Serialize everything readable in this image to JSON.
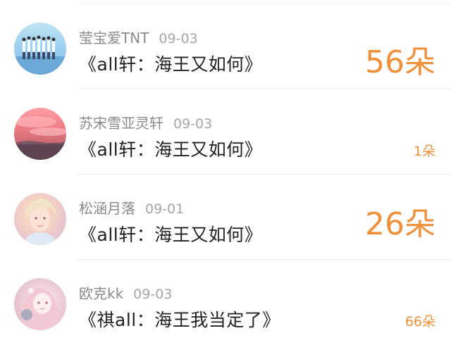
{
  "comments": [
    {
      "username": "莹宝爱TNT",
      "date": "09-03",
      "title": "《all轩：海王又如何》",
      "flowers": "56朵",
      "avatar_icon": "avatar-group-photo-icon"
    },
    {
      "username": "苏宋雪亚灵轩",
      "date": "09-03",
      "title": "《all轩：海王又如何》",
      "flowers": "1朵",
      "avatar_icon": "avatar-sunset-icon"
    },
    {
      "username": "松涵月落",
      "date": "09-01",
      "title": "《all轩：海王又如何》",
      "flowers": "26朵",
      "avatar_icon": "avatar-portrait-icon"
    },
    {
      "username": "欧克kk",
      "date": "09-03",
      "title": "《祺all：海王我当定了》",
      "flowers": "66朵",
      "avatar_icon": "avatar-anime-girl-icon"
    }
  ],
  "colors": {
    "accent": "#f0913a",
    "username": "#8a8a8a",
    "title": "#222222"
  }
}
